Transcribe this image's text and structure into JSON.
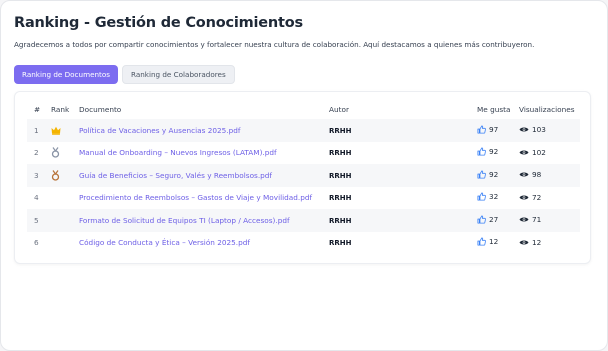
{
  "page": {
    "title": "Ranking - Gestión de Conocimientos",
    "subtitle": "Agradecemos a todos por compartir conocimientos y fortalecer nuestra cultura de colaboración. Aquí destacamos a quienes más contribuyeron."
  },
  "tabs": [
    {
      "label": "Ranking de Documentos",
      "active": true
    },
    {
      "label": "Ranking de Colaboradores",
      "active": false
    }
  ],
  "table": {
    "headers": {
      "num": "#",
      "rank": "Rank",
      "document": "Documento",
      "author": "Autor",
      "likes": "Me gusta",
      "views": "Visualizaciones"
    },
    "rows": [
      {
        "num": "1",
        "medal": "crown-icon",
        "document": "Política de Vacaciones y Ausencias 2025.pdf",
        "author": "RRHH",
        "likes": "97",
        "views": "103"
      },
      {
        "num": "2",
        "medal": "silver-medal-icon",
        "document": "Manual de Onboarding – Nuevos Ingresos (LATAM).pdf",
        "author": "RRHH",
        "likes": "92",
        "views": "102"
      },
      {
        "num": "3",
        "medal": "bronze-medal-icon",
        "document": "Guía de Beneficios – Seguro, Valés y Reembolsos.pdf",
        "author": "RRHH",
        "likes": "92",
        "views": "98"
      },
      {
        "num": "4",
        "medal": "",
        "document": "Procedimiento de Reembolsos – Gastos de Viaje y Movilidad.pdf",
        "author": "RRHH",
        "likes": "32",
        "views": "72"
      },
      {
        "num": "5",
        "medal": "",
        "document": "Formato de Solicitud de Equipos TI (Laptop / Accesos).pdf",
        "author": "RRHH",
        "likes": "27",
        "views": "71"
      },
      {
        "num": "6",
        "medal": "",
        "document": "Código de Conducta y Ética – Versión 2025.pdf",
        "author": "RRHH",
        "likes": "12",
        "views": "12"
      }
    ]
  },
  "colors": {
    "accent": "#7c6cf0",
    "link": "#6d5fe6",
    "like": "#3b82f6",
    "gold": "#f4b400",
    "silver": "#8a94a6",
    "bronze": "#b8743a"
  }
}
